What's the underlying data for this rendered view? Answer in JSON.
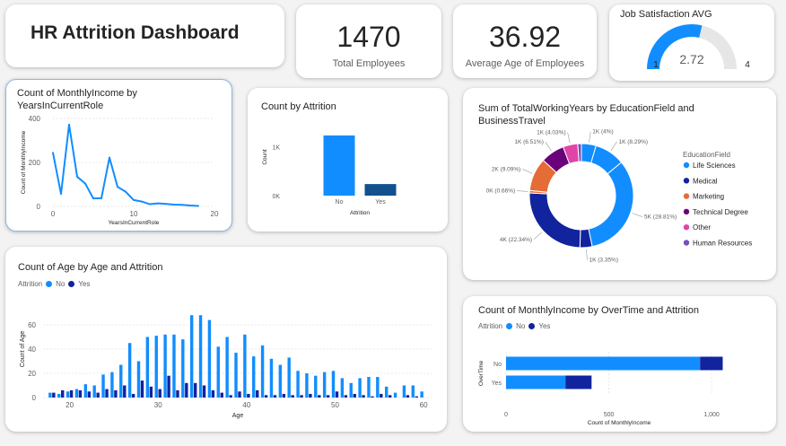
{
  "title": "HR Attrition Dashboard",
  "kpis": {
    "total_employees": {
      "value": "1470",
      "label": "Total Employees"
    },
    "avg_age": {
      "value": "36.92",
      "label": "Average Age of Employees"
    }
  },
  "colors": {
    "no": "#118dff",
    "yes": "#12239e",
    "accent": "#118dff"
  },
  "chart_data": [
    {
      "id": "gauge",
      "type": "gauge",
      "title": "Job Satisfaction AVG",
      "value": 2.72,
      "value_label": "2.72",
      "min": 1,
      "max": 4,
      "min_label": "1",
      "max_label": "4"
    },
    {
      "id": "income_by_years",
      "type": "line",
      "title": "Count of MonthlyIncome by YearsInCurrentRole",
      "xlabel": "YearsInCurrentRole",
      "ylabel": "Count of MonthlyIncome",
      "xlim": [
        0,
        20
      ],
      "ylim": [
        0,
        400
      ],
      "xticks": [
        "0",
        "10",
        "20"
      ],
      "yticks": [
        "0",
        "200",
        "400"
      ],
      "x": [
        0,
        1,
        2,
        3,
        4,
        5,
        6,
        7,
        8,
        9,
        10,
        11,
        12,
        13,
        14,
        15,
        16,
        17,
        18
      ],
      "y": [
        244,
        57,
        372,
        135,
        104,
        36,
        37,
        222,
        89,
        67,
        29,
        22,
        10,
        14,
        11,
        8,
        7,
        4,
        2
      ]
    },
    {
      "id": "count_by_attrition",
      "type": "bar",
      "title": "Count by Attrition",
      "xlabel": "Attrition",
      "ylabel": "Count",
      "categories": [
        "No",
        "Yes"
      ],
      "values": [
        1233,
        237
      ],
      "yticks": [
        "0K",
        "1K"
      ],
      "ylim": [
        0,
        1500
      ]
    },
    {
      "id": "working_years_donut",
      "type": "pie",
      "title": "Sum of TotalWorkingYears by EducationField and BusinessTravel",
      "legend_title": "EducationField",
      "legend": [
        {
          "name": "Life Sciences",
          "color": "#118dff"
        },
        {
          "name": "Medical",
          "color": "#12239e"
        },
        {
          "name": "Marketing",
          "color": "#e66c37"
        },
        {
          "name": "Technical Degree",
          "color": "#6b007b"
        },
        {
          "name": "Other",
          "color": "#e044a7"
        },
        {
          "name": "Human Resources",
          "color": "#744ec2"
        }
      ],
      "slices": [
        {
          "value": 4.0,
          "color": "#118dff",
          "label": "1K (4%)"
        },
        {
          "value": 8.29,
          "color": "#118dff",
          "label": "1K (8.29%)"
        },
        {
          "value": 28.81,
          "color": "#118dff",
          "label": "5K (28.81%)"
        },
        {
          "value": 3.35,
          "color": "#12239e",
          "label": "1K (3.35%)"
        },
        {
          "value": 22.34,
          "color": "#12239e",
          "label": "4K (22.34%)"
        },
        {
          "value": 0.66,
          "color": "#e66c37",
          "label": "0K (0.66%)"
        },
        {
          "value": 9.09,
          "color": "#e66c37",
          "label": "2K (9.09%)"
        },
        {
          "value": 6.51,
          "color": "#6b007b",
          "label": "1K (6.51%)"
        },
        {
          "value": 4.03,
          "color": "#e044a7",
          "label": "1K (4.03%)"
        },
        {
          "value": 1.0,
          "color": "#744ec2",
          "label": ""
        }
      ]
    },
    {
      "id": "age_by_attrition",
      "type": "bar",
      "title": "Count of Age by Age and Attrition",
      "xlabel": "Age",
      "ylabel": "Count of Age",
      "legend_title": "Attrition",
      "xlim": [
        17,
        61
      ],
      "ylim": [
        0,
        80
      ],
      "xticks": [
        "20",
        "30",
        "40",
        "50",
        "60"
      ],
      "yticks": [
        "0",
        "20",
        "40",
        "60"
      ],
      "x": [
        18,
        19,
        20,
        21,
        22,
        23,
        24,
        25,
        26,
        27,
        28,
        29,
        30,
        31,
        32,
        33,
        34,
        35,
        36,
        37,
        38,
        39,
        40,
        41,
        42,
        43,
        44,
        45,
        46,
        47,
        48,
        49,
        50,
        51,
        52,
        53,
        54,
        55,
        56,
        57,
        58,
        59,
        60
      ],
      "series": [
        {
          "name": "No",
          "values": [
            4,
            3,
            5,
            7,
            11,
            10,
            19,
            21,
            27,
            45,
            30,
            50,
            51,
            52,
            52,
            48,
            68,
            68,
            64,
            42,
            50,
            37,
            52,
            34,
            43,
            32,
            27,
            33,
            22,
            20,
            18,
            21,
            22,
            16,
            12,
            16,
            17,
            17,
            9,
            4,
            10,
            10,
            5
          ]
        },
        {
          "name": "Yes",
          "values": [
            4,
            6,
            6,
            6,
            5,
            4,
            7,
            6,
            10,
            3,
            14,
            9,
            7,
            18,
            6,
            12,
            12,
            10,
            6,
            4,
            2,
            5,
            3,
            6,
            2,
            2,
            3,
            2,
            2,
            3,
            2,
            2,
            5,
            2,
            3,
            2,
            1,
            3,
            2,
            0,
            2,
            1,
            0
          ]
        }
      ]
    },
    {
      "id": "income_by_overtime",
      "type": "bar",
      "orientation": "horizontal",
      "stacked": true,
      "title": "Count of MonthlyIncome by OverTime and Attrition",
      "xlabel": "Count of MonthlyIncome",
      "ylabel": "OverTime",
      "legend_title": "Attrition",
      "categories": [
        "No",
        "Yes"
      ],
      "xlim": [
        0,
        1100
      ],
      "xticks": [
        "0",
        "500",
        "1,000"
      ],
      "series": [
        {
          "name": "No",
          "values": [
            944,
            289
          ]
        },
        {
          "name": "Yes",
          "values": [
            110,
            127
          ]
        }
      ]
    }
  ]
}
